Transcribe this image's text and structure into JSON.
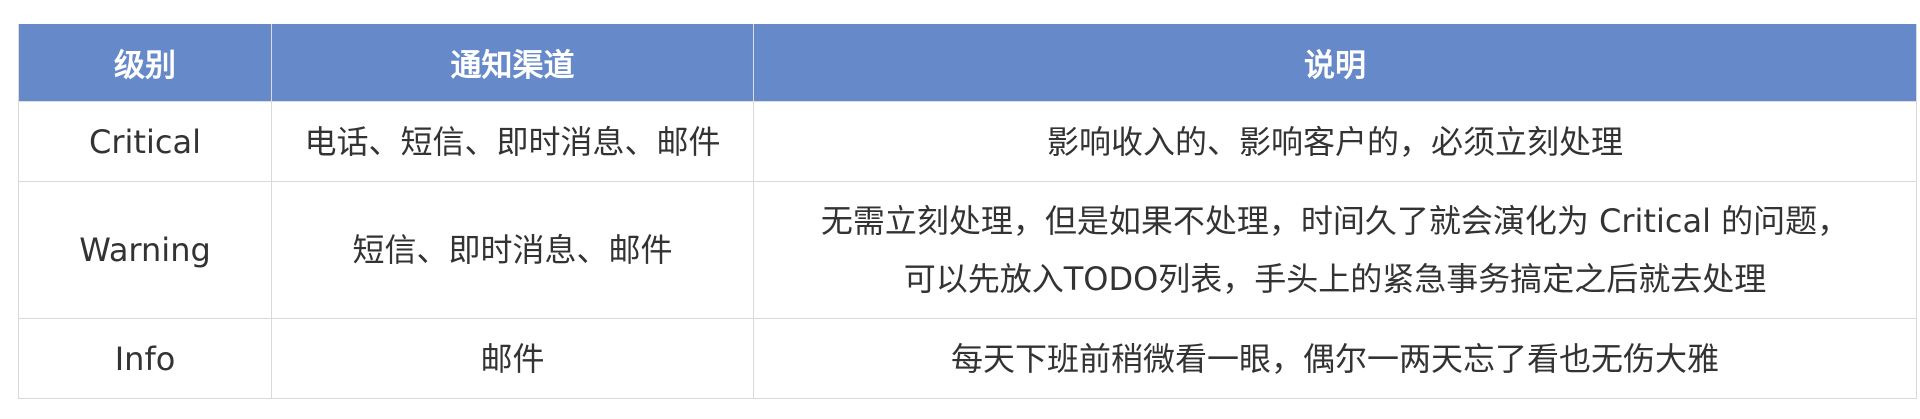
{
  "table": {
    "headers": [
      "级别",
      "通知渠道",
      "说明"
    ],
    "rows": [
      {
        "level": "Critical",
        "channels": "电话、短信、即时消息、邮件",
        "description": [
          "影响收入的、影响客户的，必须立刻处理"
        ]
      },
      {
        "level": "Warning",
        "channels": "短信、即时消息、邮件",
        "description": [
          "无需立刻处理，但是如果不处理，时间久了就会演化为 Critical 的问题，",
          "可以先放入TODO列表，手头上的紧急事务搞定之后就去处理"
        ]
      },
      {
        "level": "Info",
        "channels": "邮件",
        "description": [
          "每天下班前稍微看一眼，偶尔一两天忘了看也无伤大雅"
        ]
      }
    ],
    "colors": {
      "header_bg": "#6689c9",
      "header_text": "#ffffff",
      "body_text": "#333333",
      "border": "#d9d9d9"
    }
  }
}
